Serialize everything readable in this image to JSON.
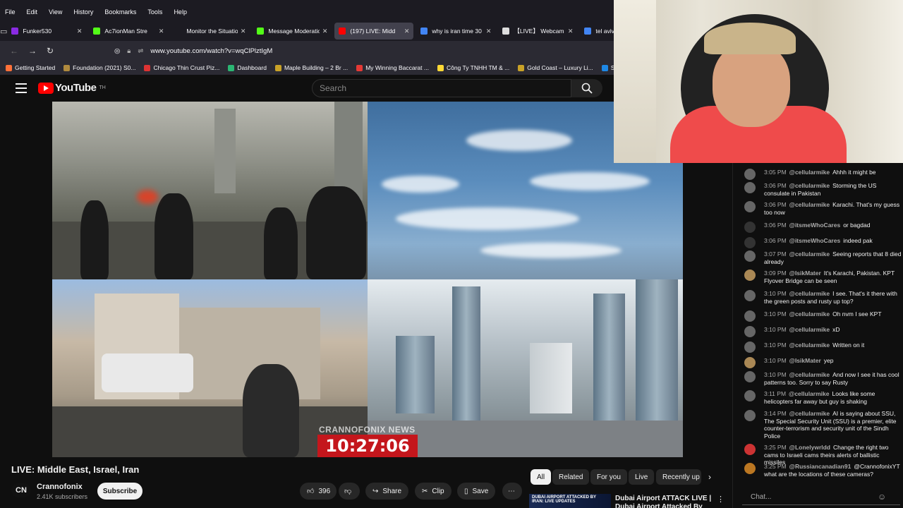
{
  "browser": {
    "menu": [
      "File",
      "Edit",
      "View",
      "History",
      "Bookmarks",
      "Tools",
      "Help"
    ],
    "tabs": [
      {
        "title": "Funker530",
        "color": "#8a2be2",
        "active": false
      },
      {
        "title": "Ac7ionMan Stre",
        "color": "#53fc18",
        "active": false
      },
      {
        "title": "Monitor the Situatio",
        "color": "#1c1b22",
        "active": false
      },
      {
        "title": "Message Moderatio",
        "color": "#53fc18",
        "active": false
      },
      {
        "title": "(197) LIVE: Midd",
        "color": "#ff0000",
        "active": true
      },
      {
        "title": "why is iran time 30",
        "color": "#4285f4",
        "active": false
      },
      {
        "title": "【LIVE】 Webcam V",
        "color": "#dddddd",
        "active": false
      },
      {
        "title": "tel avivi",
        "color": "#4285f4",
        "active": false
      }
    ],
    "url": "www.youtube.com/watch?v=wqClPlztIgM",
    "bookmarks": [
      {
        "label": "Getting Started",
        "color": "#ff7139"
      },
      {
        "label": "Foundation (2021) S0...",
        "color": "#b08a3e"
      },
      {
        "label": "Chicago Thin Crust Piz...",
        "color": "#d33"
      },
      {
        "label": "Dashboard",
        "color": "#2bb673"
      },
      {
        "label": "Maple Building – 2 Br ...",
        "color": "#c9a227"
      },
      {
        "label": "My Winning Baccarat ...",
        "color": "#e53935"
      },
      {
        "label": "Công Ty TNHH TM & ...",
        "color": "#fdd835"
      },
      {
        "label": "Gold Coast – Luxury Li...",
        "color": "#c9a227"
      },
      {
        "label": "Sign in - Dre",
        "color": "#1e88e5"
      }
    ]
  },
  "youtube": {
    "logo": "YouTube",
    "country": "TH",
    "search_placeholder": "Search",
    "video": {
      "watermark": "CRANNOFONIX NEWS",
      "clock": "10:27:06",
      "title": "LIVE: Middle East, Israel, Iran",
      "channel": "Crannofonix",
      "channel_initials": "CN",
      "subscribers": "2.41K subscribers",
      "subscribe_label": "Subscribe",
      "likes": "396",
      "share_label": "Share",
      "clip_label": "Clip",
      "save_label": "Save"
    },
    "chips": [
      "All",
      "Related",
      "For you",
      "Live",
      "Recently up"
    ],
    "related": {
      "thumb_text": "DUBAI AIRPORT ATTACKED BY IRAN: LIVE UPDATES",
      "title": "Dubai Airport ATTACK LIVE | Dubai Airport Attacked By Iran"
    }
  },
  "chat": {
    "messages": [
      {
        "time": "3:05 PM",
        "user": "@cellularmike",
        "text": "Ahhh it might be"
      },
      {
        "time": "3:06 PM",
        "user": "@cellularmike",
        "text": "Storming the US consulate in Pakistan"
      },
      {
        "time": "3:06 PM",
        "user": "@cellularmike",
        "text": "Karachi. That's my guess too now"
      },
      {
        "time": "3:06 PM",
        "user": "@itsmeWhoCares",
        "text": "or bagdad"
      },
      {
        "time": "3:06 PM",
        "user": "@itsmeWhoCares",
        "text": "indeed pak"
      },
      {
        "time": "3:07 PM",
        "user": "@cellularmike",
        "text": "Seeing reports that 8 died already"
      },
      {
        "time": "3:09 PM",
        "user": "@IsikMater",
        "text": "It's Karachi, Pakistan. KPT Flyover Bridge can be seen"
      },
      {
        "time": "3:10 PM",
        "user": "@cellularmike",
        "text": "I see. That's it there with the green posts and rusty up top?"
      },
      {
        "time": "3:10 PM",
        "user": "@cellularmike",
        "text": "Oh nvm I see KPT"
      },
      {
        "time": "3:10 PM",
        "user": "@cellularmike",
        "text": "xD"
      },
      {
        "time": "3:10 PM",
        "user": "@cellularmike",
        "text": "Written on it"
      },
      {
        "time": "3:10 PM",
        "user": "@IsikMater",
        "text": "yep"
      },
      {
        "time": "3:10 PM",
        "user": "@cellularmike",
        "text": "And now I see it has cool patterns too. Sorry to say Rusty"
      },
      {
        "time": "3:11 PM",
        "user": "@cellularmike",
        "text": "Looks like some helicopters far away but guy is shaking"
      },
      {
        "time": "3:14 PM",
        "user": "@cellularmike",
        "text": "AI is saying about SSU, The Special Security Unit (SSU) is a premier, elite counter-terrorism and security unit of the Sindh Police"
      },
      {
        "time": "3:25 PM",
        "user": "@Lonelywrldd",
        "text": "Change the right two cams to Israeli cams theirs alerts of ballistic missiles"
      },
      {
        "time": "3:25 PM",
        "user": "@Russiancanadian91",
        "text": "@CrannofonixYT what are the locations of these cameras?"
      }
    ],
    "input_placeholder": "Chat..."
  }
}
